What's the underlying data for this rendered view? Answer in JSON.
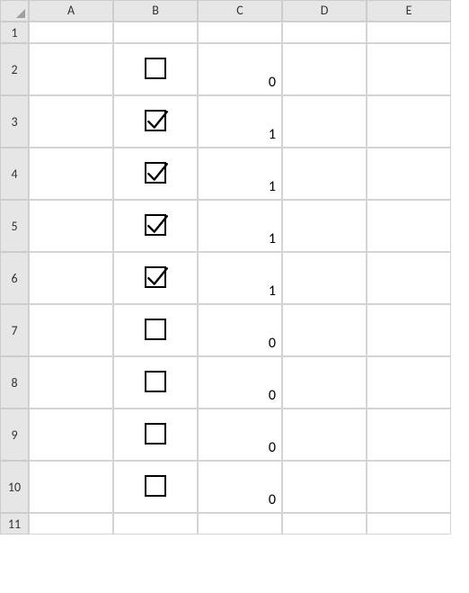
{
  "columns": [
    "A",
    "B",
    "C",
    "D",
    "E"
  ],
  "rows": [
    {
      "n": "1",
      "height": "short",
      "checkbox": null,
      "c": ""
    },
    {
      "n": "2",
      "height": "tall",
      "checkbox": false,
      "c": "0"
    },
    {
      "n": "3",
      "height": "tall",
      "checkbox": true,
      "c": "1"
    },
    {
      "n": "4",
      "height": "tall",
      "checkbox": true,
      "c": "1"
    },
    {
      "n": "5",
      "height": "tall",
      "checkbox": true,
      "c": "1"
    },
    {
      "n": "6",
      "height": "tall",
      "checkbox": true,
      "c": "1"
    },
    {
      "n": "7",
      "height": "tall",
      "checkbox": false,
      "c": "0"
    },
    {
      "n": "8",
      "height": "tall",
      "checkbox": false,
      "c": "0"
    },
    {
      "n": "9",
      "height": "tall",
      "checkbox": false,
      "c": "0"
    },
    {
      "n": "10",
      "height": "tall",
      "checkbox": false,
      "c": "0"
    },
    {
      "n": "11",
      "height": "short",
      "checkbox": null,
      "c": ""
    }
  ]
}
